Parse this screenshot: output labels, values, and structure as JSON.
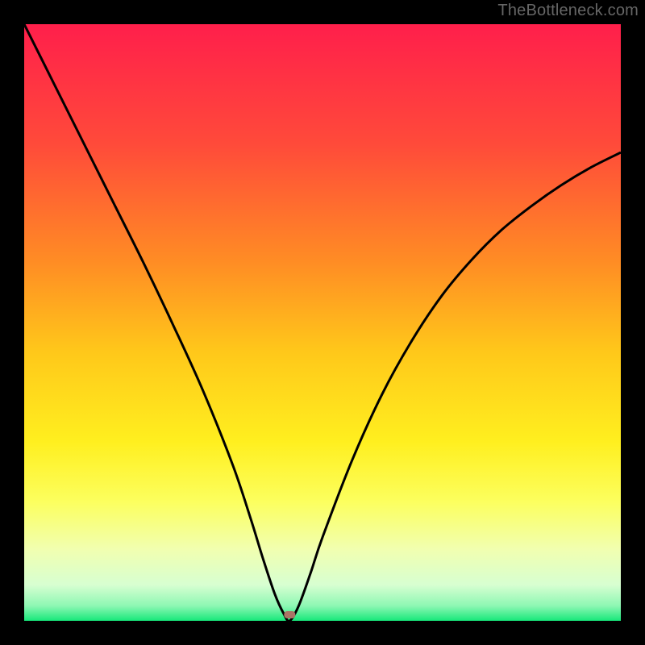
{
  "watermark": "TheBottleneck.com",
  "marker": {
    "x_frac": 0.445,
    "color": "#aa7566"
  },
  "chart_data": {
    "type": "line",
    "title": "",
    "xlabel": "",
    "ylabel": "",
    "xlim": [
      0,
      100
    ],
    "ylim": [
      0,
      100
    ],
    "grid": false,
    "legend": false,
    "background_gradient": {
      "stops": [
        {
          "pos": 0.0,
          "color": "#ff1f4b"
        },
        {
          "pos": 0.2,
          "color": "#ff4a3a"
        },
        {
          "pos": 0.4,
          "color": "#ff8d24"
        },
        {
          "pos": 0.55,
          "color": "#ffc81a"
        },
        {
          "pos": 0.7,
          "color": "#ffef1f"
        },
        {
          "pos": 0.8,
          "color": "#fcff5e"
        },
        {
          "pos": 0.88,
          "color": "#f1ffb0"
        },
        {
          "pos": 0.94,
          "color": "#d7ffd1"
        },
        {
          "pos": 0.975,
          "color": "#8df7b3"
        },
        {
          "pos": 1.0,
          "color": "#16e87a"
        }
      ]
    },
    "series": [
      {
        "name": "curve",
        "color": "#000000",
        "x": [
          0,
          5,
          10,
          15,
          20,
          25,
          30,
          35,
          38,
          40,
          42,
          43.5,
          44.5,
          46,
          48,
          50,
          55,
          60,
          65,
          70,
          75,
          80,
          85,
          90,
          95,
          100
        ],
        "y": [
          100,
          90,
          80,
          70,
          60,
          49.5,
          38.5,
          26,
          17,
          10.5,
          4.5,
          1.2,
          0,
          2.5,
          8,
          14,
          27,
          38,
          47,
          54.5,
          60.5,
          65.5,
          69.5,
          73,
          76,
          78.5
        ]
      }
    ],
    "annotations": []
  }
}
